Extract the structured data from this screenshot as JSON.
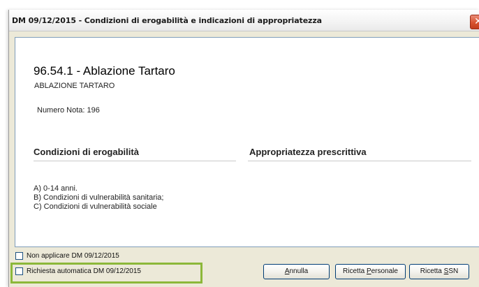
{
  "window": {
    "title": "DM 09/12/2015 - Condizioni di erogabilità e indicazioni di appropriatezza",
    "close_glyph": "✕"
  },
  "procedure": {
    "title": "96.54.1 - Ablazione Tartaro",
    "subtitle": "ABLAZIONE TARTARO",
    "nota": "Numero Nota: 196"
  },
  "sections": {
    "left_heading": "Condizioni di erogabilità",
    "right_heading": "Appropriatezza prescrittiva",
    "conditions": [
      "A) 0-14 anni.",
      "B) Condizioni di vulnerabilità sanitaria;",
      "C) Condizioni di vulnerabilità sociale"
    ]
  },
  "options": {
    "non_applicare": "Non applicare DM 09/12/2015",
    "richiesta_auto": "Richiesta automatica DM 09/12/2015"
  },
  "buttons": {
    "annulla": {
      "pre": "",
      "mnemonic": "A",
      "post": "nnulla"
    },
    "personale": {
      "pre": "Ricetta ",
      "mnemonic": "P",
      "post": "ersonale"
    },
    "ssn": {
      "pre": "Ricetta ",
      "mnemonic": "S",
      "post": "SN"
    }
  },
  "colors": {
    "highlight": "#8cb83a",
    "close_button": "#d8532f"
  }
}
